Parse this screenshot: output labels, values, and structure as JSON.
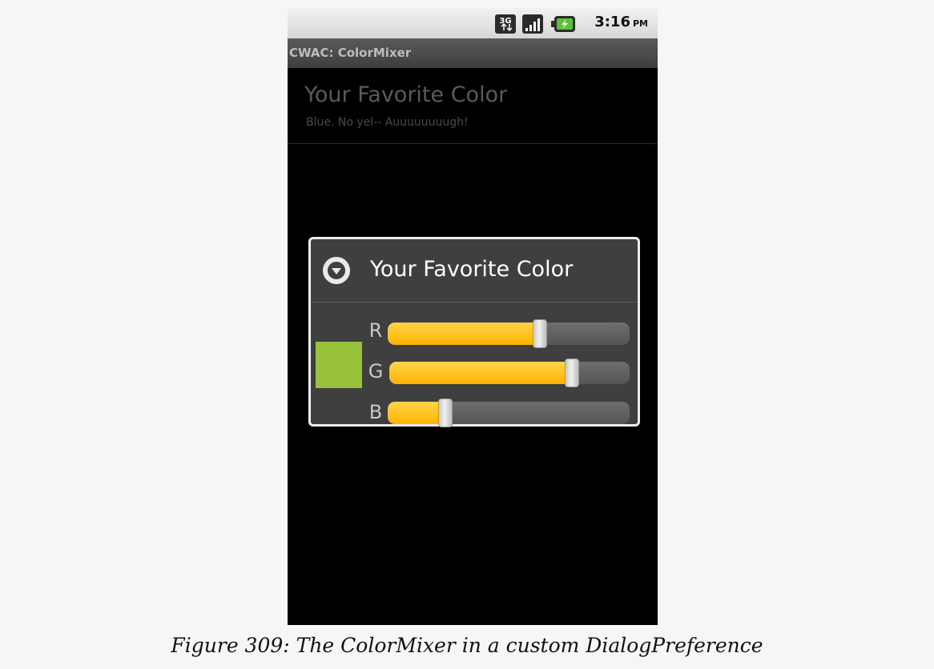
{
  "status_bar": {
    "time": "3:16",
    "ampm": "PM",
    "network_type": "3G",
    "icons": [
      "network-3g-icon",
      "signal-icon",
      "battery-charging-icon"
    ]
  },
  "app": {
    "title": "CWAC: ColorMixer"
  },
  "preference": {
    "title": "Your Favorite Color",
    "summary": "Blue.  No yel--  Auuuuuuuugh!"
  },
  "dialog": {
    "title": "Your Favorite Color",
    "icon": "dropdown-circle-icon",
    "swatch_color": "#99c13c",
    "sliders": [
      {
        "label": "R",
        "value": 0.63
      },
      {
        "label": "G",
        "value": 0.76
      },
      {
        "label": "B",
        "value": 0.24
      }
    ]
  },
  "colors": {
    "slider_fill": "#ffb400",
    "dialog_background": "#3f3f3f"
  },
  "caption": "Figure 309: The ColorMixer in a custom DialogPreference"
}
